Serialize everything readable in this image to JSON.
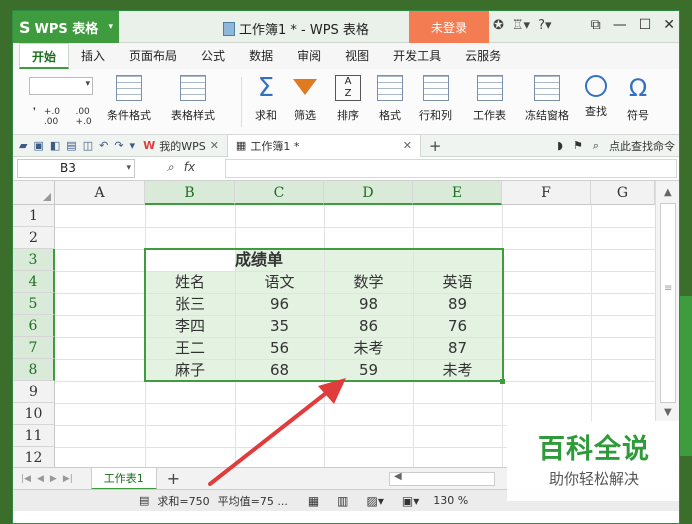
{
  "app": {
    "name": "WPS 表格",
    "logo_glyph": "S",
    "doc_title": "工作簿1 * - WPS 表格",
    "login_label": "未登录",
    "help_label": "?"
  },
  "menu": {
    "tabs": [
      "开始",
      "插入",
      "页面布局",
      "公式",
      "数据",
      "审阅",
      "视图",
      "开发工具",
      "云服务"
    ]
  },
  "ribbon": {
    "cond_format": "条件格式",
    "table_style": "表格样式",
    "sum": "求和",
    "filter": "筛选",
    "sort": "排序",
    "format": "格式",
    "rowcol": "行和列",
    "worksheet": "工作表",
    "freeze": "冻结窗格",
    "find": "查找",
    "symbol": "符号",
    "dec_inc": "+.0 .00",
    "dec_dec": ".00 +.0"
  },
  "tabs_bar": {
    "mywps": "我的WPS",
    "doc": "工作簿1 *",
    "search": "点此查找命令"
  },
  "formula_bar": {
    "cell_ref": "B3",
    "fx": "fx"
  },
  "columns": [
    "A",
    "B",
    "C",
    "D",
    "E",
    "F",
    "G"
  ],
  "rows": [
    "1",
    "2",
    "3",
    "4",
    "5",
    "6",
    "7",
    "8",
    "9",
    "10",
    "11",
    "12"
  ],
  "table": {
    "title": "成绩单",
    "header": [
      "姓名",
      "语文",
      "数学",
      "英语"
    ],
    "body": [
      [
        "张三",
        "96",
        "98",
        "89"
      ],
      [
        "李四",
        "35",
        "86",
        "76"
      ],
      [
        "王二",
        "56",
        "未考",
        "87"
      ],
      [
        "麻子",
        "68",
        "59",
        "未考"
      ]
    ]
  },
  "sheet": {
    "tab": "工作表1"
  },
  "status": {
    "sum": "求和=750",
    "avg": "平均值=75 ...",
    "zoom": "130 %"
  },
  "watermark": {
    "main": "百科全说",
    "sub": "助你轻松解决"
  },
  "colors": {
    "accent": "#3e9c3e",
    "login": "#f37c52",
    "selection": "#e4f2e2",
    "arrow": "#e03c3c"
  }
}
